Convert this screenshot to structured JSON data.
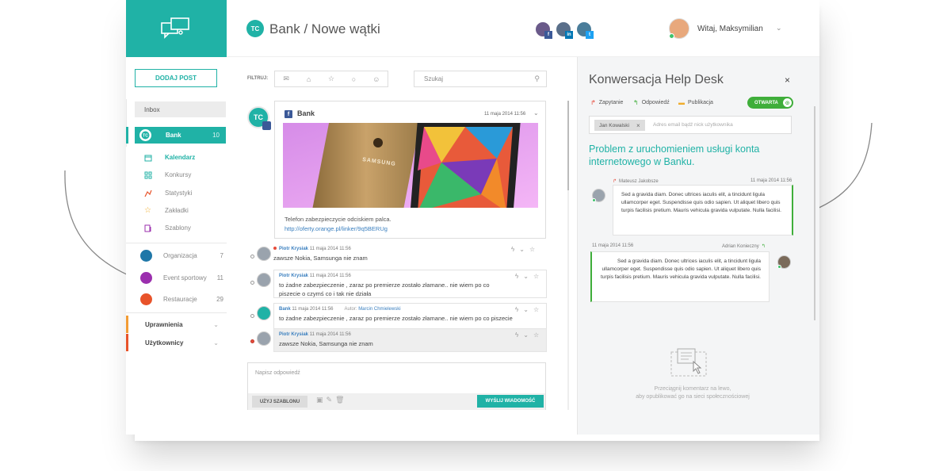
{
  "sidebar": {
    "add_post_label": "DODAJ POST",
    "inbox_label": "Inbox",
    "bank": {
      "label": "Bank",
      "count": "10"
    },
    "sub_items": [
      {
        "label": "Kalendarz",
        "icon": "calendar-icon",
        "active": true
      },
      {
        "label": "Konkursy",
        "icon": "grid-icon",
        "active": false
      },
      {
        "label": "Statystyki",
        "icon": "stats-icon",
        "active": false
      },
      {
        "label": "Zakładki",
        "icon": "star-icon",
        "active": false
      },
      {
        "label": "Szablony",
        "icon": "template-icon",
        "active": false
      }
    ],
    "orgs": [
      {
        "label": "Organizacja",
        "count": "7",
        "color": "#1f77a8"
      },
      {
        "label": "Event sportowy",
        "count": "11",
        "color": "#9b2fae"
      },
      {
        "label": "Restauracje",
        "count": "29",
        "color": "#e8532a"
      }
    ],
    "sections": [
      {
        "label": "Uprawnienia",
        "accent": "#f39c34"
      },
      {
        "label": "Użytkownicy",
        "accent": "#e8532a"
      }
    ]
  },
  "header": {
    "logo_text": "TC",
    "title": "Bank / Nowe wątki",
    "social": [
      {
        "network": "facebook",
        "badge": "f",
        "color": "#3b5998"
      },
      {
        "network": "linkedin",
        "badge": "in",
        "color": "#0077b5"
      },
      {
        "network": "twitter",
        "badge": "t",
        "color": "#1da1f2"
      }
    ],
    "user_greeting": "Witaj, Maksymilian"
  },
  "feed": {
    "filter_label": "FILTRUJ:",
    "search_placeholder": "Szukaj",
    "post": {
      "author": "Bank",
      "date": "11 maja 2014 11:56",
      "image_brand": "SAMSUNG",
      "text": "Telefon zabezpieczycie odciskiem palca.",
      "link": "http://oferty.orange.pl/linker/9q5BERUg"
    },
    "comments": [
      {
        "author": "Piotr Krysiak",
        "date": "11 maja 2014 11:56",
        "text": "zawsze Nokia, Samsunga nie znam",
        "red_dot": true,
        "grey": false,
        "label": "",
        "author2": ""
      },
      {
        "author": "Piotr Krysiak",
        "date": "11 maja 2014 11:56",
        "text": "to żadne zabezpieczenie , zaraz po premierze zostało złamane.. nie wiem po co piszecie o czymś co i tak nie działa",
        "red_dot": false,
        "grey": false,
        "label": "",
        "author2": ""
      },
      {
        "author": "Bank",
        "date": "11 maja 2014 11:56",
        "text": "to żadne zabezpieczenie , zaraz po premierze zostało złamane.. nie wiem po co piszecie",
        "red_dot": false,
        "grey": false,
        "label": "Autor:",
        "author2": "Marcin Chmielewski"
      },
      {
        "author": "Piotr Krysiak",
        "date": "11 maja 2014 11:56",
        "text": "zawsze Nokia, Samsunga nie znam",
        "red_dot": false,
        "grey": true,
        "label": "",
        "author2": ""
      }
    ],
    "reply_placeholder": "Napisz odpowiedź",
    "template_button": "UŻYJ SZABLONU",
    "send_button": "WYŚLIJ WIADOMOŚĆ"
  },
  "helpdesk": {
    "title": "Konwersacja Help Desk",
    "close": "×",
    "tabs": [
      {
        "label": "Zapytanie",
        "icon": "request-icon",
        "color": "#e74c3c"
      },
      {
        "label": "Odpowiedź",
        "icon": "reply-icon",
        "color": "#3fae3a"
      },
      {
        "label": "Publikacja",
        "icon": "publish-icon",
        "color": "#f0ad2c"
      }
    ],
    "status_label": "OTWARTA",
    "recipient_tag": "Jan Kowalski",
    "recipient_placeholder": "Adres email bądź nick użytkownika",
    "subject": "Problem z uruchomieniem usługi konta internetowego w Banku.",
    "messages": [
      {
        "author": "Mateusz Jakobsze",
        "date": "11 maja 2014 11:56",
        "text": "Sed a gravida diam. Donec ultrices iaculis elit, a tincidunt ligula ullamcorper eget. Suspendisse quis odio sapien. Ut aliquet libero quis turpis facilisis pretium. Mauris vehicula gravida vulputate. Nulla facilisi."
      },
      {
        "author": "Adrian Konieczny",
        "date": "11 maja 2014 11:56",
        "text": "Sed a gravida diam. Donec ultrices iaculis elit, a tincidunt ligula ullamcorper eget. Suspendisse quis odio sapien. Ut aliquet libero quis turpis facilisis pretium. Mauris vehicula gravida vulputate. Nulla facilisi."
      }
    ],
    "drop_text_1": "Przeciągnij komentarz na lewo,",
    "drop_text_2": "aby opublikować go na sieci społecznościowej"
  }
}
